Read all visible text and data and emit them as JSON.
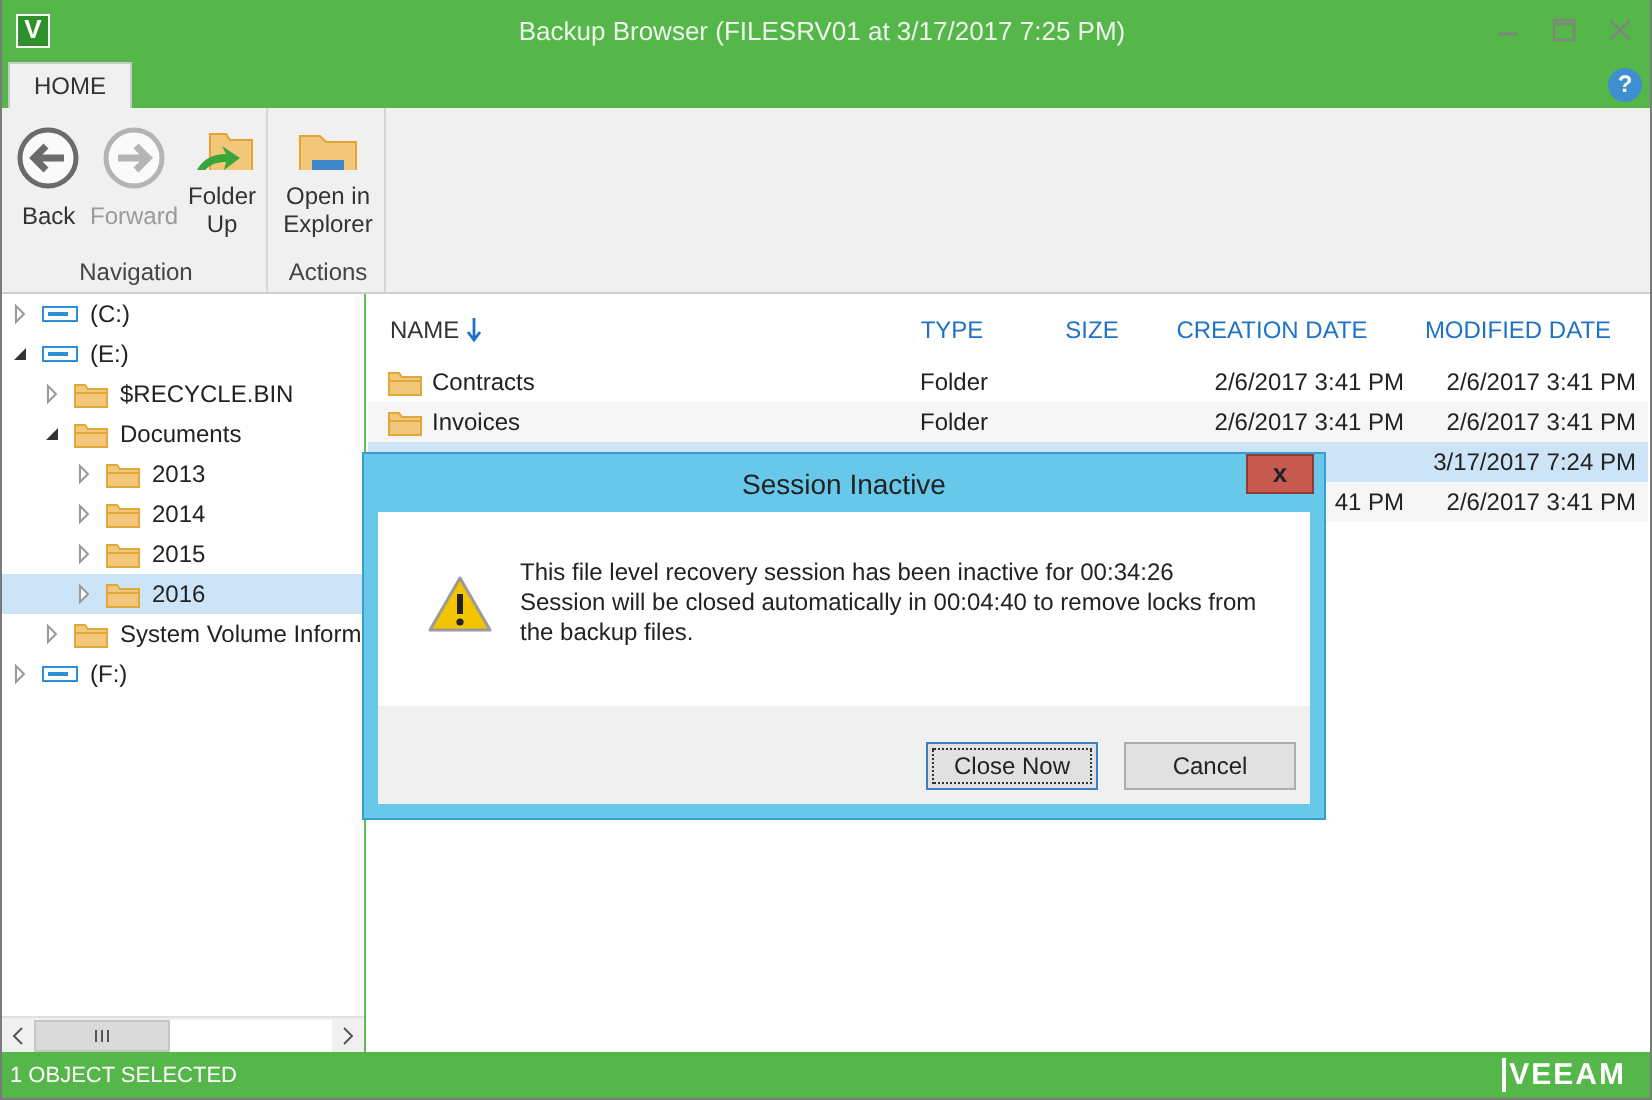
{
  "window": {
    "app_icon": "V",
    "title": "Backup Browser (FILESRV01 at 3/17/2017 7:25 PM)",
    "help": "?"
  },
  "tabs": [
    {
      "label": "HOME",
      "selected": true
    }
  ],
  "ribbon": {
    "groups": [
      {
        "label": "Navigation",
        "buttons": [
          {
            "kind": "back",
            "label": "Back",
            "disabled": false
          },
          {
            "kind": "forward",
            "label": "Forward",
            "disabled": true
          },
          {
            "kind": "folder-up",
            "label": "Folder Up",
            "disabled": false
          }
        ]
      },
      {
        "label": "Actions",
        "buttons": [
          {
            "kind": "explorer",
            "label": "Open in Explorer",
            "disabled": false
          }
        ]
      }
    ]
  },
  "tree": [
    {
      "kind": "drive",
      "label": "(C:)",
      "expanded": false,
      "selected": false
    },
    {
      "kind": "drive",
      "label": "(E:)",
      "expanded": true,
      "selected": false,
      "children": [
        {
          "kind": "folder",
          "label": "$RECYCLE.BIN",
          "expanded": false,
          "selected": false
        },
        {
          "kind": "folder",
          "label": "Documents",
          "expanded": true,
          "selected": false,
          "children": [
            {
              "kind": "folder",
              "label": "2013",
              "expanded": false,
              "selected": false
            },
            {
              "kind": "folder",
              "label": "2014",
              "expanded": false,
              "selected": false
            },
            {
              "kind": "folder",
              "label": "2015",
              "expanded": false,
              "selected": false
            },
            {
              "kind": "folder",
              "label": "2016",
              "expanded": false,
              "selected": true
            }
          ]
        },
        {
          "kind": "folder",
          "label": "System Volume Inform",
          "expanded": false,
          "selected": false
        }
      ]
    },
    {
      "kind": "drive",
      "label": "(F:)",
      "expanded": false,
      "selected": false
    }
  ],
  "table": {
    "columns": [
      {
        "label": "NAME",
        "sorted": true
      },
      {
        "label": "TYPE",
        "sorted": false
      },
      {
        "label": "SIZE",
        "sorted": false
      },
      {
        "label": "CREATION DATE",
        "sorted": false
      },
      {
        "label": "MODIFIED DATE",
        "sorted": false
      }
    ],
    "rows": [
      {
        "name": "Contracts",
        "type": "Folder",
        "created": "2/6/2017 3:41 PM",
        "modified": "2/6/2017 3:41 PM",
        "selected": false
      },
      {
        "name": "Invoices",
        "type": "Folder",
        "created": "2/6/2017 3:41 PM",
        "modified": "2/6/2017 3:41 PM",
        "selected": false
      },
      {
        "modified": "3/17/2017 7:24 PM",
        "selected": true
      },
      {
        "created": "41 PM",
        "modified": "2/6/2017 3:41 PM",
        "selected": false
      }
    ]
  },
  "dialog": {
    "title": "Session Inactive",
    "close": "x",
    "message": [
      "This file level recovery session has been inactive for 00:34:26",
      "Session will be closed automatically in 00:04:40 to remove locks from the backup files."
    ],
    "buttons": [
      {
        "label": "Close Now",
        "focused": true
      },
      {
        "label": "Cancel",
        "focused": false
      }
    ]
  },
  "status_bar": {
    "text": "1 OBJECT SELECTED",
    "logo": "VEEAM"
  }
}
